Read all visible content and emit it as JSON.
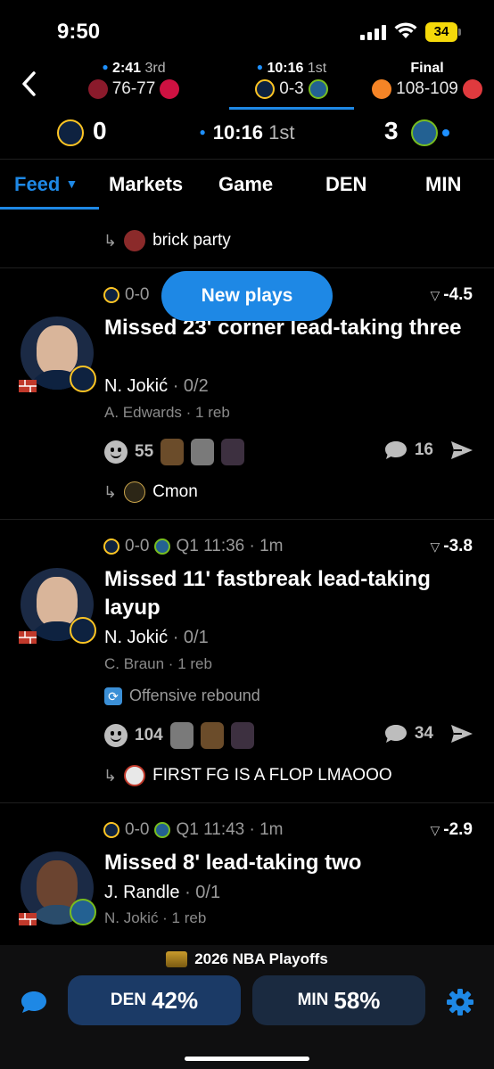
{
  "status_bar": {
    "time": "9:50",
    "battery": "34"
  },
  "games": [
    {
      "top_clock": "2:41",
      "top_period": "3rd",
      "live": true,
      "score": "76-77",
      "away_color": "#8a1a2b",
      "home_color": "#ce1141",
      "active": false
    },
    {
      "top_clock": "10:16",
      "top_period": "1st",
      "live": true,
      "score": "0-3",
      "away_color": "#0e2240",
      "home_color": "#236192",
      "active": true
    },
    {
      "top_clock": "Final",
      "top_period": "",
      "live": false,
      "score": "108-109",
      "away_color": "#f58426",
      "home_color": "#e03a3e",
      "active": false
    }
  ],
  "scoreboard": {
    "away_score": "0",
    "home_score": "3",
    "clock": "10:16",
    "period": "1st"
  },
  "tabs": [
    "Feed",
    "Markets",
    "Game",
    "DEN",
    "MIN"
  ],
  "feed": {
    "top_reply": "brick party",
    "new_plays": "New plays",
    "plays": [
      {
        "score": "0-0",
        "time": "",
        "odds": "-4.5",
        "title": "Missed 23' corner lead-taking three",
        "player": "N. Jokić",
        "stat": "0/2",
        "secondary": "A. Edwards · 1 reb",
        "info": "",
        "reactions": "55",
        "comments": "16",
        "reply": "Cmon"
      },
      {
        "score": "0-0",
        "time": "Q1 11:36 · 1m",
        "odds": "-3.8",
        "title": "Missed 11' fastbreak lead-taking layup",
        "player": "N. Jokić",
        "stat": "0/1",
        "secondary": "C. Braun · 1 reb",
        "info": "Offensive rebound",
        "reactions": "104",
        "comments": "34",
        "reply": "FIRST FG IS A FLOP LMAOOO"
      },
      {
        "score": "0-0",
        "time": "Q1 11:43 · 1m",
        "odds": "-2.9",
        "title": "Missed 8' lead-taking two",
        "player": "J. Randle",
        "stat": "0/1",
        "secondary": "N. Jokić · 1 reb"
      }
    ]
  },
  "bottom": {
    "event": "2026 NBA Playoffs",
    "den_label": "DEN",
    "den_pct": "42%",
    "min_label": "MIN",
    "min_pct": "58%"
  },
  "colors": {
    "accent": "#1e88e5",
    "nuggets": "#0e2240",
    "wolves": "#236192"
  }
}
